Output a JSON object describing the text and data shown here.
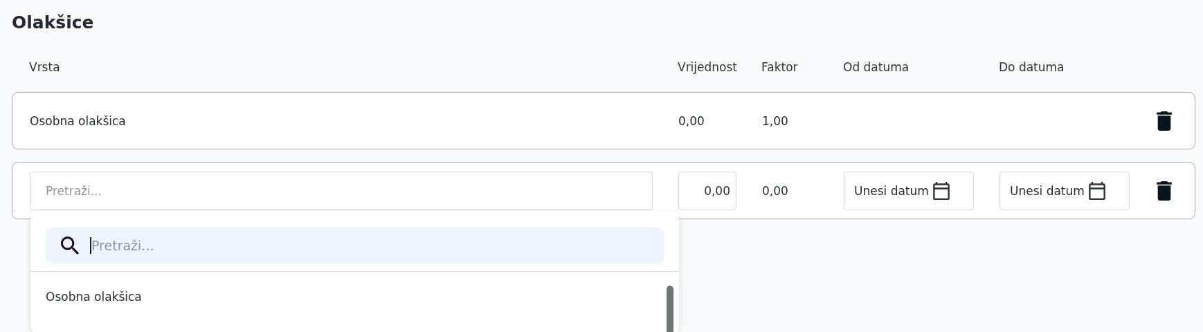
{
  "title": "Olakšice",
  "columns": [
    "Vrsta",
    "Vrijednost",
    "Faktor",
    "Od datuma",
    "Do datuma"
  ],
  "rows": [
    {
      "kind": "static",
      "type": "Osobna olakšica",
      "value": "0,00",
      "factor": "1,00"
    },
    {
      "kind": "edit",
      "type_placeholder": "Pretraži...",
      "value": "0,00",
      "factor": "0,00",
      "from_label": "Unesi datum",
      "to_label": "Unesi datum",
      "dropdown": {
        "search_placeholder": "Pretraži...",
        "options": [
          "Osobna olakšica"
        ]
      }
    }
  ]
}
